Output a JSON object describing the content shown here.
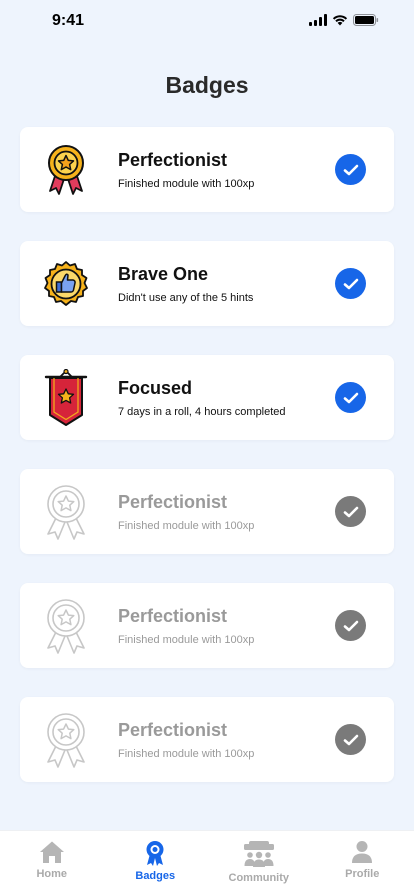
{
  "status_bar": {
    "time": "9:41"
  },
  "header": {
    "title": "Badges"
  },
  "colors": {
    "accent": "#1766e8",
    "completed_check": "#1766e8",
    "locked_check": "#7a7a7a",
    "background": "#eef4fd",
    "locked_text": "#9a9a9a"
  },
  "badges": [
    {
      "title": "Perfectionist",
      "description": "Finished module with 100xp",
      "icon": "medal-star-icon",
      "completed": true
    },
    {
      "title": "Brave One",
      "description": "Didn't use any of the 5 hints",
      "icon": "thumbs-up-seal-icon",
      "completed": true
    },
    {
      "title": "Focused",
      "description": "7 days in a roll, 4 hours completed",
      "icon": "banner-star-icon",
      "completed": true
    },
    {
      "title": "Perfectionist",
      "description": "Finished module with 100xp",
      "icon": "medal-outline-icon",
      "completed": false
    },
    {
      "title": "Perfectionist",
      "description": "Finished module with 100xp",
      "icon": "medal-outline-icon",
      "completed": false
    },
    {
      "title": "Perfectionist",
      "description": "Finished module with 100xp",
      "icon": "medal-outline-icon",
      "completed": false
    }
  ],
  "tab_bar": {
    "tabs": [
      {
        "label": "Home",
        "icon": "home-icon",
        "active": false
      },
      {
        "label": "Badges",
        "icon": "badge-icon",
        "active": true
      },
      {
        "label": "Community",
        "icon": "community-icon",
        "active": false
      },
      {
        "label": "Profile",
        "icon": "profile-icon",
        "active": false
      }
    ]
  }
}
